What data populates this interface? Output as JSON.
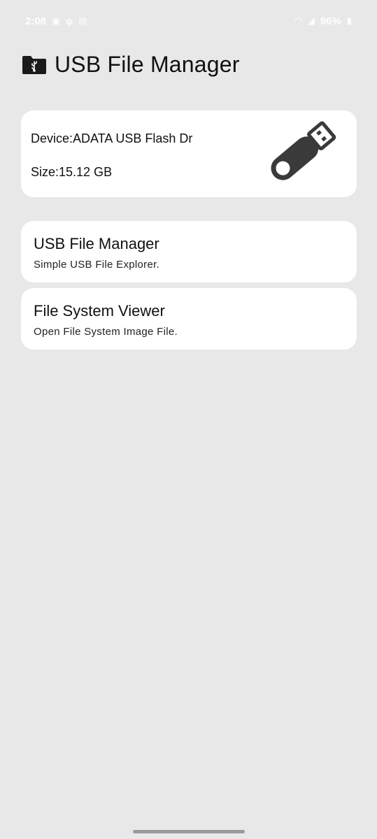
{
  "status_bar": {
    "time": "2:08",
    "battery": "96%",
    "left_icons": [
      "image-icon",
      "usb-icon",
      "sim-icon"
    ],
    "right_icons": [
      "wifi-icon",
      "signal-icon",
      "battery-icon"
    ]
  },
  "header": {
    "title": "USB File Manager",
    "icon": "folder-usb-icon"
  },
  "device": {
    "name": "Device:ADATA USB Flash Dr",
    "size": "Size:15.12 GB",
    "icon": "usb-drive-icon"
  },
  "menu": [
    {
      "title": "USB File Manager",
      "subtitle": "Simple USB File Explorer."
    },
    {
      "title": "File System Viewer",
      "subtitle": "Open File System Image File."
    }
  ],
  "colors": {
    "background": "#e8e8e8",
    "card": "#ffffff",
    "icon": "#3a3a3a"
  }
}
